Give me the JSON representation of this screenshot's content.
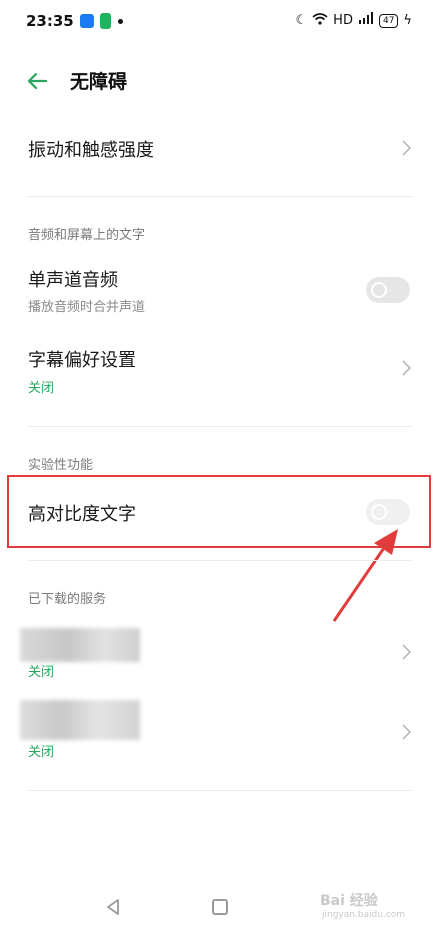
{
  "status_bar": {
    "time": "23:35",
    "network": "HD",
    "battery": "47",
    "icons": [
      "app-icon-blue",
      "app-icon-green",
      "dot-icon",
      "moon-icon",
      "wifi-icon",
      "signal-icon",
      "battery-icon",
      "charging-icon"
    ]
  },
  "header": {
    "title": "无障碍",
    "accent_color": "#2aa55e"
  },
  "rows": {
    "vibration": {
      "title": "振动和触感强度"
    },
    "section_audio": "音频和屏幕上的文字",
    "mono_audio": {
      "title": "单声道音频",
      "subtitle": "播放音频时合并声道",
      "toggle_on": false
    },
    "captions": {
      "title": "字幕偏好设置",
      "status": "关闭"
    },
    "section_experimental": "实验性功能",
    "high_contrast": {
      "title": "高对比度文字",
      "toggle_on": false
    },
    "section_downloaded": "已下载的服务",
    "service_1": {
      "status": "关闭"
    },
    "service_2": {
      "status": "关闭"
    }
  },
  "annotation": {
    "highlight_color": "#e03c3c"
  },
  "watermark": {
    "main": "Bai 经验",
    "sub": "jingyan.baidu.com"
  }
}
